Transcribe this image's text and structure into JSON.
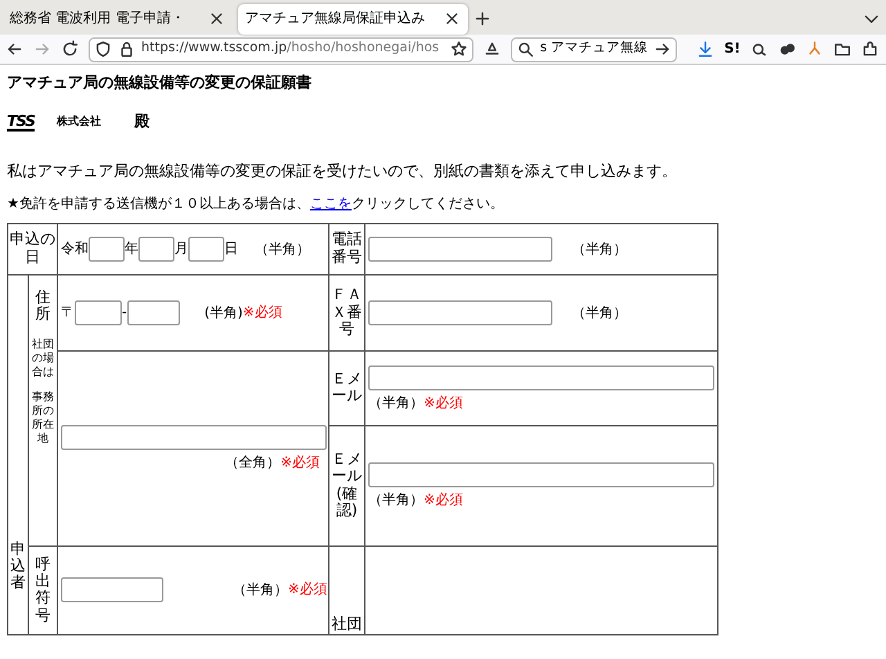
{
  "browser": {
    "tabs": [
      {
        "title": "総務省 電波利用 電子申請・",
        "selected": false
      },
      {
        "title": "アマチュア無線局保証申込み",
        "selected": true
      }
    ],
    "url_host": "https://www.tsscom.jp",
    "url_path": "/hosho/hoshonegai/hos",
    "search_text": "s アマチュア無線",
    "extension_label": "S!"
  },
  "page": {
    "heading": "アマチュア局の無線設備等の変更の保証願書",
    "logo_text": "TSS",
    "company": "株式会社",
    "honorific": "殿",
    "intro": "私はアマチュア局の無線設備等の変更の保証を受けたいので、別紙の書類を添えて申し込みます。",
    "notice_before": "★免許を申請する送信機が１０以上ある場合は、",
    "notice_link": "ここを",
    "notice_after": "クリックしてください。"
  },
  "form": {
    "date": {
      "label": "申込の日",
      "era": "令和",
      "year_unit": "年",
      "month_unit": "月",
      "day_unit": "日",
      "note": "（半角）"
    },
    "phone": {
      "label": "電話番号",
      "note": "（半角）"
    },
    "applicant_label": "申込者",
    "address": {
      "label": "住所",
      "sublabel_1": "社団の場合は",
      "sublabel_2": "事務所の所在地",
      "postal_mark": "〒",
      "hyphen": "-",
      "postal_note": "(半角)",
      "postal_required": "※必須",
      "note": "（全角）",
      "required": "※必須"
    },
    "fax": {
      "label": "ＦＡＸ番号",
      "note": "（半角）"
    },
    "email": {
      "label": "Ｅメール",
      "note": "（半角）",
      "required": "※必須"
    },
    "email_confirm": {
      "label": "Ｅメール(確認)",
      "note": "（半角）",
      "required": "※必須"
    },
    "callsign": {
      "label": "呼出符号",
      "note": "（半角）",
      "required": "※必須"
    },
    "club_name": {
      "label": "社団"
    }
  }
}
